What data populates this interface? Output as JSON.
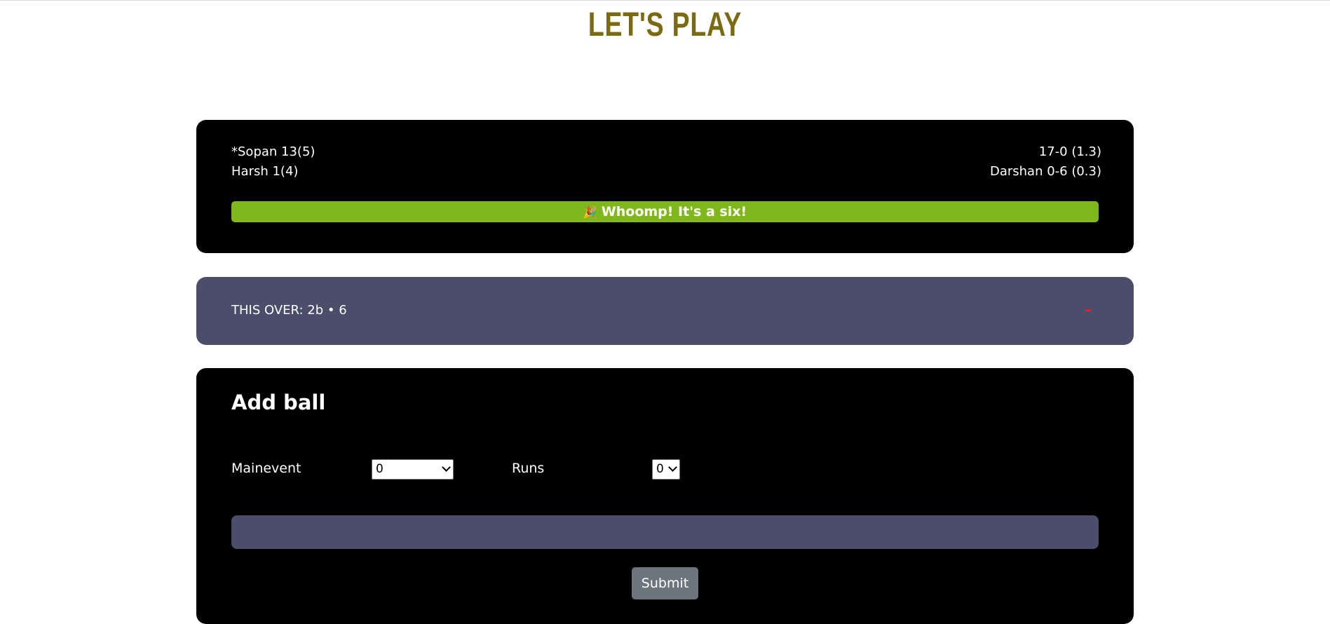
{
  "page_title": "LET'S PLAY",
  "scoreboard": {
    "striker": "*Sopan 13(5)",
    "non_striker": "Harsh 1(4)",
    "team_score": "17-0 (1.3)",
    "bowler": "Darshan 0-6 (0.3)",
    "banner_icon": "🎉",
    "banner_text": "Whoomp! It's a six!"
  },
  "this_over": {
    "text": "THIS OVER: 2b • 6"
  },
  "add_ball": {
    "title": "Add ball",
    "mainevent_label": "Mainevent",
    "mainevent_value": "0",
    "runs_label": "Runs",
    "runs_value": "0",
    "submit_label": "Submit"
  },
  "colors": {
    "title": "#7b6a12",
    "banner": "#80b81b",
    "over_panel": "#4a4e6a",
    "submit": "#6c757d"
  }
}
